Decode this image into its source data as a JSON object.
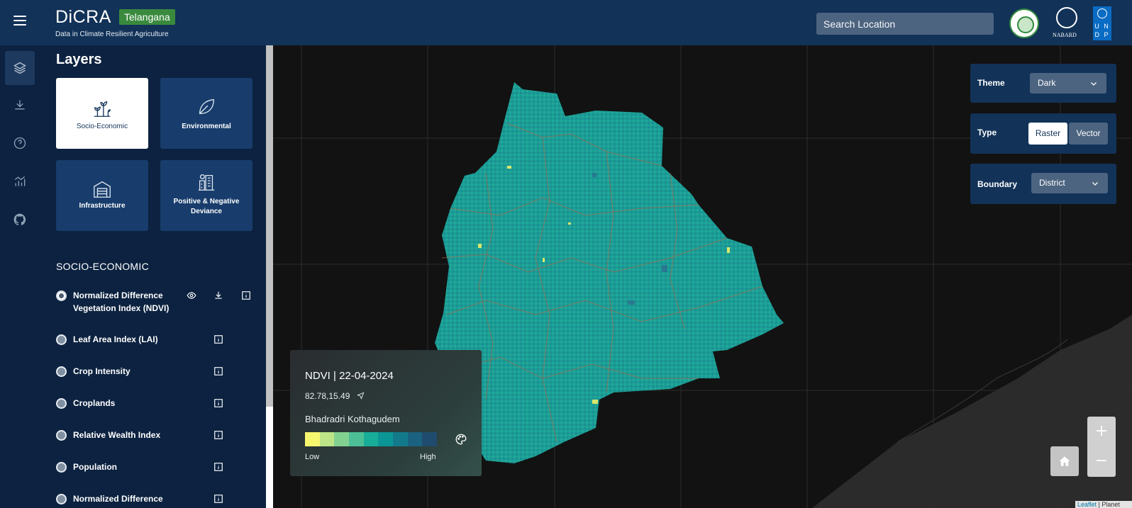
{
  "header": {
    "brand": "DiCRA",
    "state_tag": "Telangana",
    "subtitle": "Data in Climate Resilient Agriculture",
    "search_placeholder": "Search Location",
    "logos": [
      "telangana-emblem",
      "NABARD",
      "UNDP"
    ],
    "nabard_text": "NABARD",
    "undp_text": "U N D P"
  },
  "rail": {
    "items": [
      "layers-icon",
      "download-icon",
      "help-icon",
      "analytics-icon",
      "github-icon"
    ],
    "active": "layers-icon"
  },
  "layers": {
    "title": "Layers",
    "cards": [
      {
        "label": "Socio-Economic",
        "icon": "sprout-icon",
        "active": true
      },
      {
        "label": "Environmental",
        "icon": "leaf-icon",
        "active": false
      },
      {
        "label": "Infrastructure",
        "icon": "warehouse-icon",
        "active": false
      },
      {
        "label": "Positive & Negative Deviance",
        "icon": "buildings-icon",
        "active": false
      }
    ],
    "section": "SOCIO-ECONOMIC",
    "items": [
      {
        "label": "Normalized Difference Vegetation Index (NDVI)",
        "selected": true
      },
      {
        "label": "Leaf Area Index (LAI)",
        "selected": false
      },
      {
        "label": "Crop Intensity",
        "selected": false
      },
      {
        "label": "Croplands",
        "selected": false
      },
      {
        "label": "Relative Wealth Index",
        "selected": false
      },
      {
        "label": "Population",
        "selected": false
      },
      {
        "label": "Normalized Difference",
        "selected": false
      }
    ]
  },
  "legend": {
    "title": "NDVI | 22-04-2024",
    "coords": "82.78,15.49",
    "location": "Bhadradri Kothagudem",
    "low": "Low",
    "high": "High",
    "colors": [
      "#f6f66f",
      "#bde487",
      "#82d191",
      "#4cbf96",
      "#17ad98",
      "#0c9596",
      "#137a8c",
      "#1a627f",
      "#1f4c6e"
    ]
  },
  "controls": {
    "theme_label": "Theme",
    "theme_value": "Dark",
    "type_label": "Type",
    "type_options": [
      "Raster",
      "Vector"
    ],
    "type_selected": "Raster",
    "boundary_label": "Boundary",
    "boundary_value": "District"
  },
  "map": {
    "zoom_in": "+",
    "zoom_out": "−",
    "attribution_link": "Leaflet",
    "attribution_rest": " | Planet"
  },
  "colors": {
    "header_bg": "#123258",
    "panel_bg": "#0c2240",
    "card_bg": "#183d6c",
    "raster": "#1a9e96",
    "tag_green": "#3a8a3e"
  }
}
